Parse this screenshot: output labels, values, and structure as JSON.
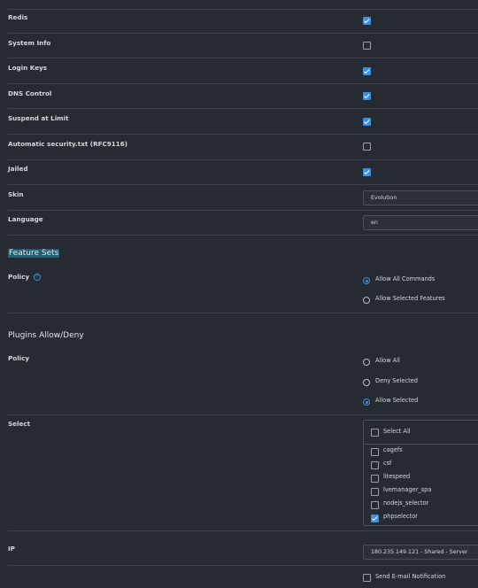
{
  "rows": [
    {
      "label": "Redis",
      "checked": true
    },
    {
      "label": "System Info",
      "checked": false
    },
    {
      "label": "Login Keys",
      "checked": true
    },
    {
      "label": "DNS Control",
      "checked": true
    },
    {
      "label": "Suspend at Limit",
      "checked": true
    },
    {
      "label": "Automatic security.txt (RFC9116)",
      "checked": false
    },
    {
      "label": "Jailed",
      "checked": true
    }
  ],
  "skin": {
    "label": "Skin",
    "value": "Evolution"
  },
  "language": {
    "label": "Language",
    "value": "en"
  },
  "feature_sets": {
    "title": "Feature Sets",
    "policy_label": "Policy",
    "help_icon": "help-circle-icon",
    "options": [
      {
        "label": "Allow All Commands",
        "selected": true
      },
      {
        "label": "Allow Selected Features",
        "selected": false
      }
    ]
  },
  "plugins": {
    "title": "Plugins Allow/Deny",
    "policy_label": "Policy",
    "options": [
      {
        "label": "Allow All",
        "selected": false
      },
      {
        "label": "Deny Selected",
        "selected": false
      },
      {
        "label": "Allow Selected",
        "selected": true
      }
    ],
    "select_label": "Select",
    "select_all_label": "Select All",
    "items": [
      {
        "label": "cagefs",
        "checked": false
      },
      {
        "label": "csf",
        "checked": false
      },
      {
        "label": "litespeed",
        "checked": false
      },
      {
        "label": "lvemanager_spa",
        "checked": false
      },
      {
        "label": "nodejs_selector",
        "checked": false
      },
      {
        "label": "phpselector",
        "checked": true
      }
    ]
  },
  "ip": {
    "label": "IP",
    "value": "180.235.149.121 - Shared - Server"
  },
  "notification": {
    "label": "Send E-mail Notification",
    "checked": false
  },
  "colors": {
    "background": "#262a31",
    "accent": "#3d8fe0",
    "highlight": "#1f5f6f"
  }
}
